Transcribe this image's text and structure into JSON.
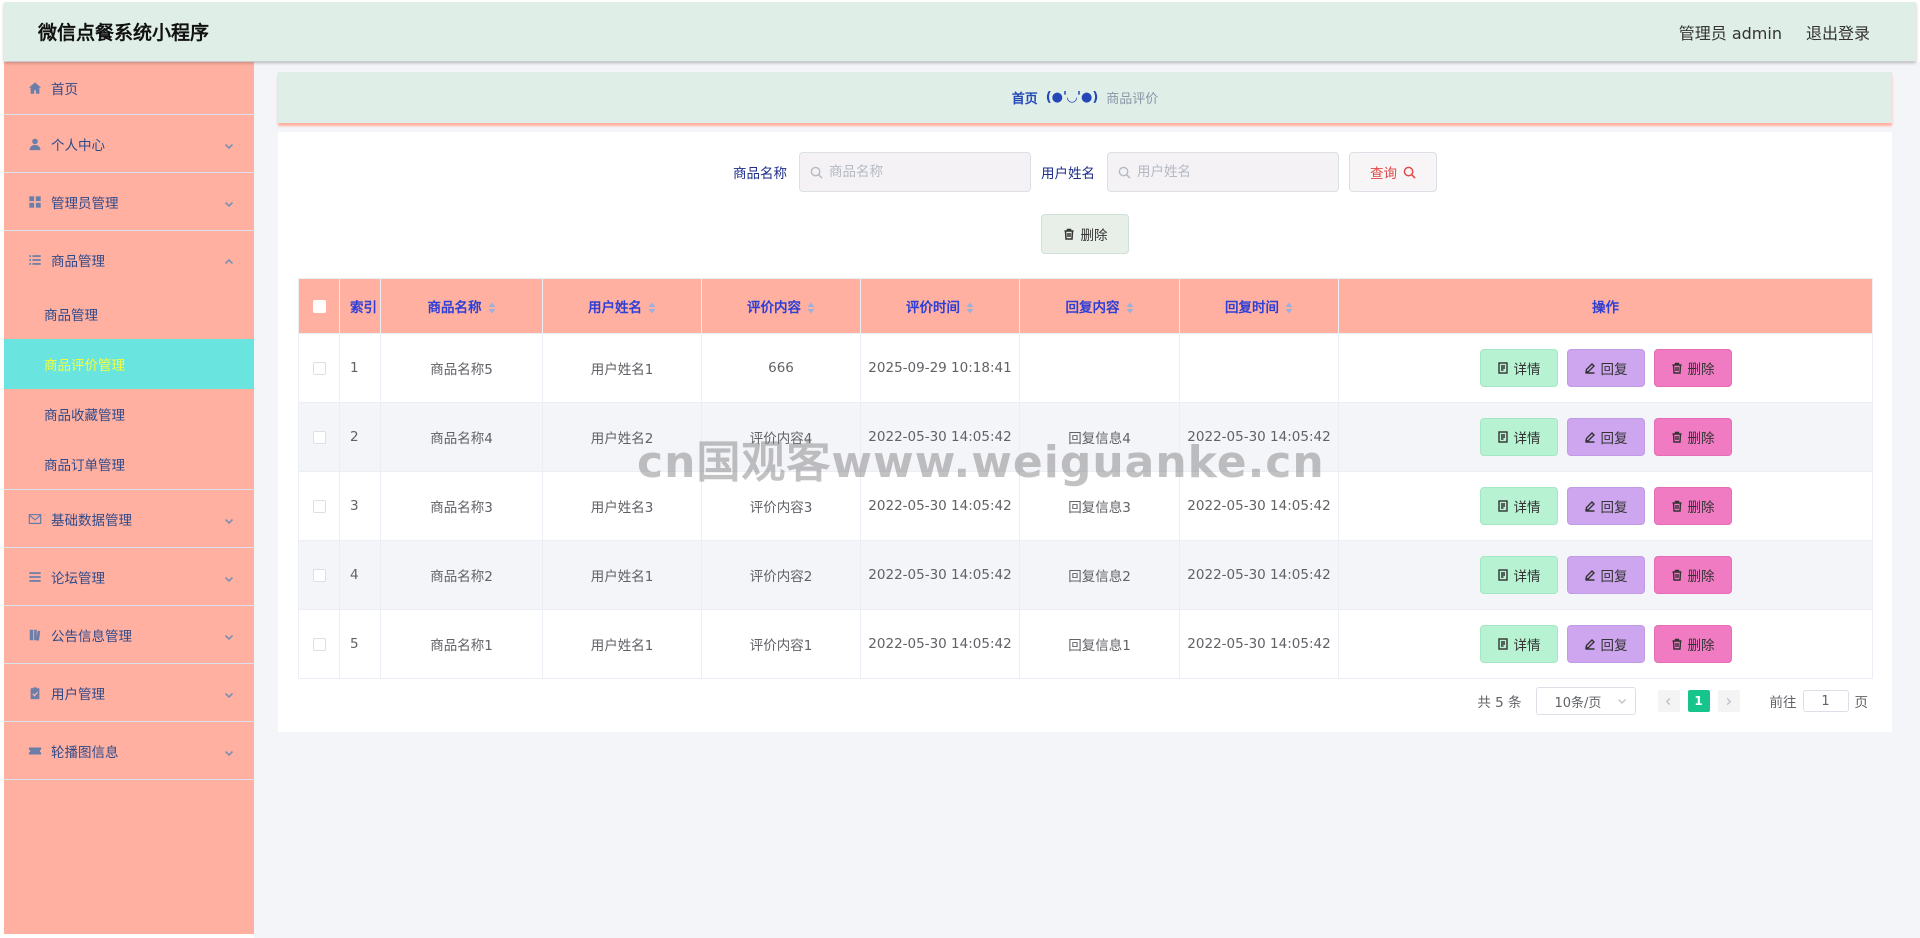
{
  "header": {
    "title": "微信点餐系统小程序",
    "user_label": "管理员 admin",
    "logout_label": "退出登录"
  },
  "sidebar": {
    "items": [
      {
        "label": "首页",
        "icon": "home-icon"
      },
      {
        "label": "个人中心",
        "icon": "user-icon"
      },
      {
        "label": "管理员管理",
        "icon": "grid-icon"
      },
      {
        "label": "商品管理",
        "icon": "list-icon",
        "expanded": true
      },
      {
        "label": "基础数据管理",
        "icon": "mail-icon"
      },
      {
        "label": "论坛管理",
        "icon": "menu-icon"
      },
      {
        "label": "公告信息管理",
        "icon": "book-icon"
      },
      {
        "label": "用户管理",
        "icon": "clipboard-icon"
      },
      {
        "label": "轮播图信息",
        "icon": "ticket-icon"
      }
    ],
    "sub_items": [
      {
        "label": "商品管理"
      },
      {
        "label": "商品评价管理",
        "active": true
      },
      {
        "label": "商品收藏管理"
      },
      {
        "label": "商品订单管理"
      }
    ]
  },
  "breadcrumb": {
    "home": "首页",
    "separator": "(●'◡'●)",
    "current": "商品评价"
  },
  "search": {
    "product_label": "商品名称",
    "product_placeholder": "商品名称",
    "user_label": "用户姓名",
    "user_placeholder": "用户姓名",
    "query_label": "查询"
  },
  "bulk_delete_label": "删除",
  "table": {
    "headers": {
      "index": "索引",
      "product": "商品名称",
      "user": "用户姓名",
      "content": "评价内容",
      "time": "评价时间",
      "reply": "回复内容",
      "reply_time": "回复时间",
      "ops": "操作"
    },
    "rows": [
      {
        "index": "1",
        "product": "商品名称5",
        "user": "用户姓名1",
        "content": "666",
        "time": "2025-09-29 10:18:41",
        "reply": "",
        "reply_time": ""
      },
      {
        "index": "2",
        "product": "商品名称4",
        "user": "用户姓名2",
        "content": "评价内容4",
        "time": "2022-05-30 14:05:42",
        "reply": "回复信息4",
        "reply_time": "2022-05-30 14:05:42"
      },
      {
        "index": "3",
        "product": "商品名称3",
        "user": "用户姓名3",
        "content": "评价内容3",
        "time": "2022-05-30 14:05:42",
        "reply": "回复信息3",
        "reply_time": "2022-05-30 14:05:42"
      },
      {
        "index": "4",
        "product": "商品名称2",
        "user": "用户姓名1",
        "content": "评价内容2",
        "time": "2022-05-30 14:05:42",
        "reply": "回复信息2",
        "reply_time": "2022-05-30 14:05:42"
      },
      {
        "index": "5",
        "product": "商品名称1",
        "user": "用户姓名1",
        "content": "评价内容1",
        "time": "2022-05-30 14:05:42",
        "reply": "回复信息1",
        "reply_time": "2022-05-30 14:05:42"
      }
    ],
    "ops": {
      "detail": "详情",
      "reply": "回复",
      "delete": "删除"
    }
  },
  "pagination": {
    "total": "共 5 条",
    "page_size": "10条/页",
    "current_page": "1",
    "goto_prefix": "前往",
    "goto_value": "1",
    "goto_suffix": "页"
  },
  "watermark": "cn国观客www.weiguanke.cn",
  "colors": {
    "header_bg": "#dfeee6",
    "sidebar_bg": "#ffb0a1",
    "active_item_bg": "#6ae4de",
    "table_header_bg": "#ffb0a1",
    "detail_btn": "#b7f3d2",
    "reply_btn": "#cda6ef",
    "delete_btn": "#f07bc2",
    "page_active": "#17c58c"
  }
}
